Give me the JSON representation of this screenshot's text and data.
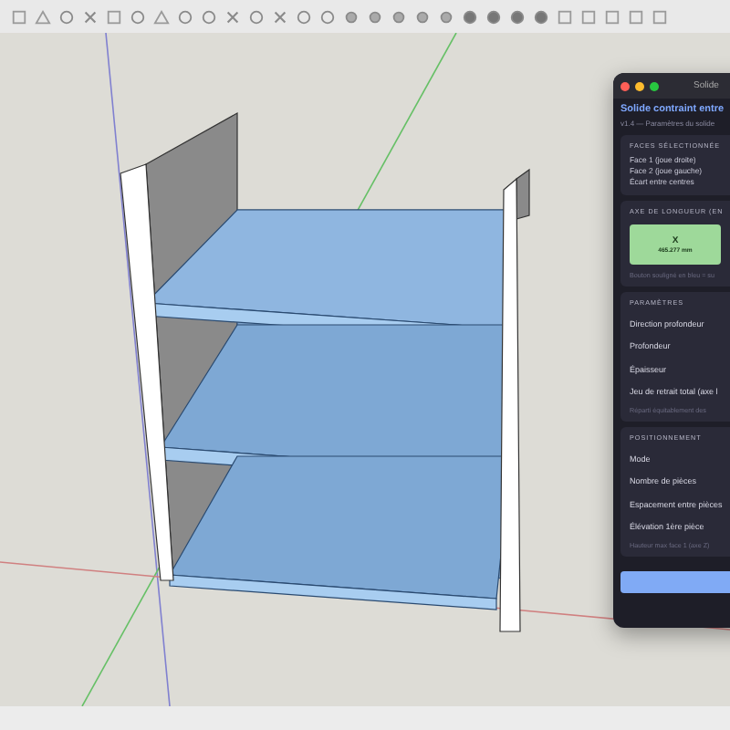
{
  "panel": {
    "window_title": "Solide",
    "heading": "Solide contraint entre",
    "subtitle": "v1.4 — Paramètres du solide",
    "sections": [
      {
        "kind": "list",
        "title": "FACES SÉLECTIONNÉE",
        "lines": [
          "Face 1 (joue droite)",
          "Face 2 (joue gauche)",
          "Écart entre centres"
        ]
      },
      {
        "kind": "axis",
        "title": "AXE DE LONGUEUR (EN",
        "axes": [
          {
            "label": "X",
            "value": "465.277 mm",
            "selected": true
          }
        ],
        "note": "Bouton souligné en bleu = su"
      },
      {
        "kind": "fields",
        "title": "PARAMÈTRES",
        "lines": [
          "Direction profondeur",
          "Profondeur",
          "Épaisseur",
          "Jeu de retrait total (axe l"
        ],
        "note": "Réparti équitablement des"
      },
      {
        "kind": "fields",
        "title": "POSITIONNEMENT",
        "lines": [
          "Mode",
          "Nombre de pièces",
          "Espacement entre pièces",
          "Élévation 1ère pièce"
        ],
        "note": "Hauteur max face 1 (axe Z)"
      }
    ]
  }
}
